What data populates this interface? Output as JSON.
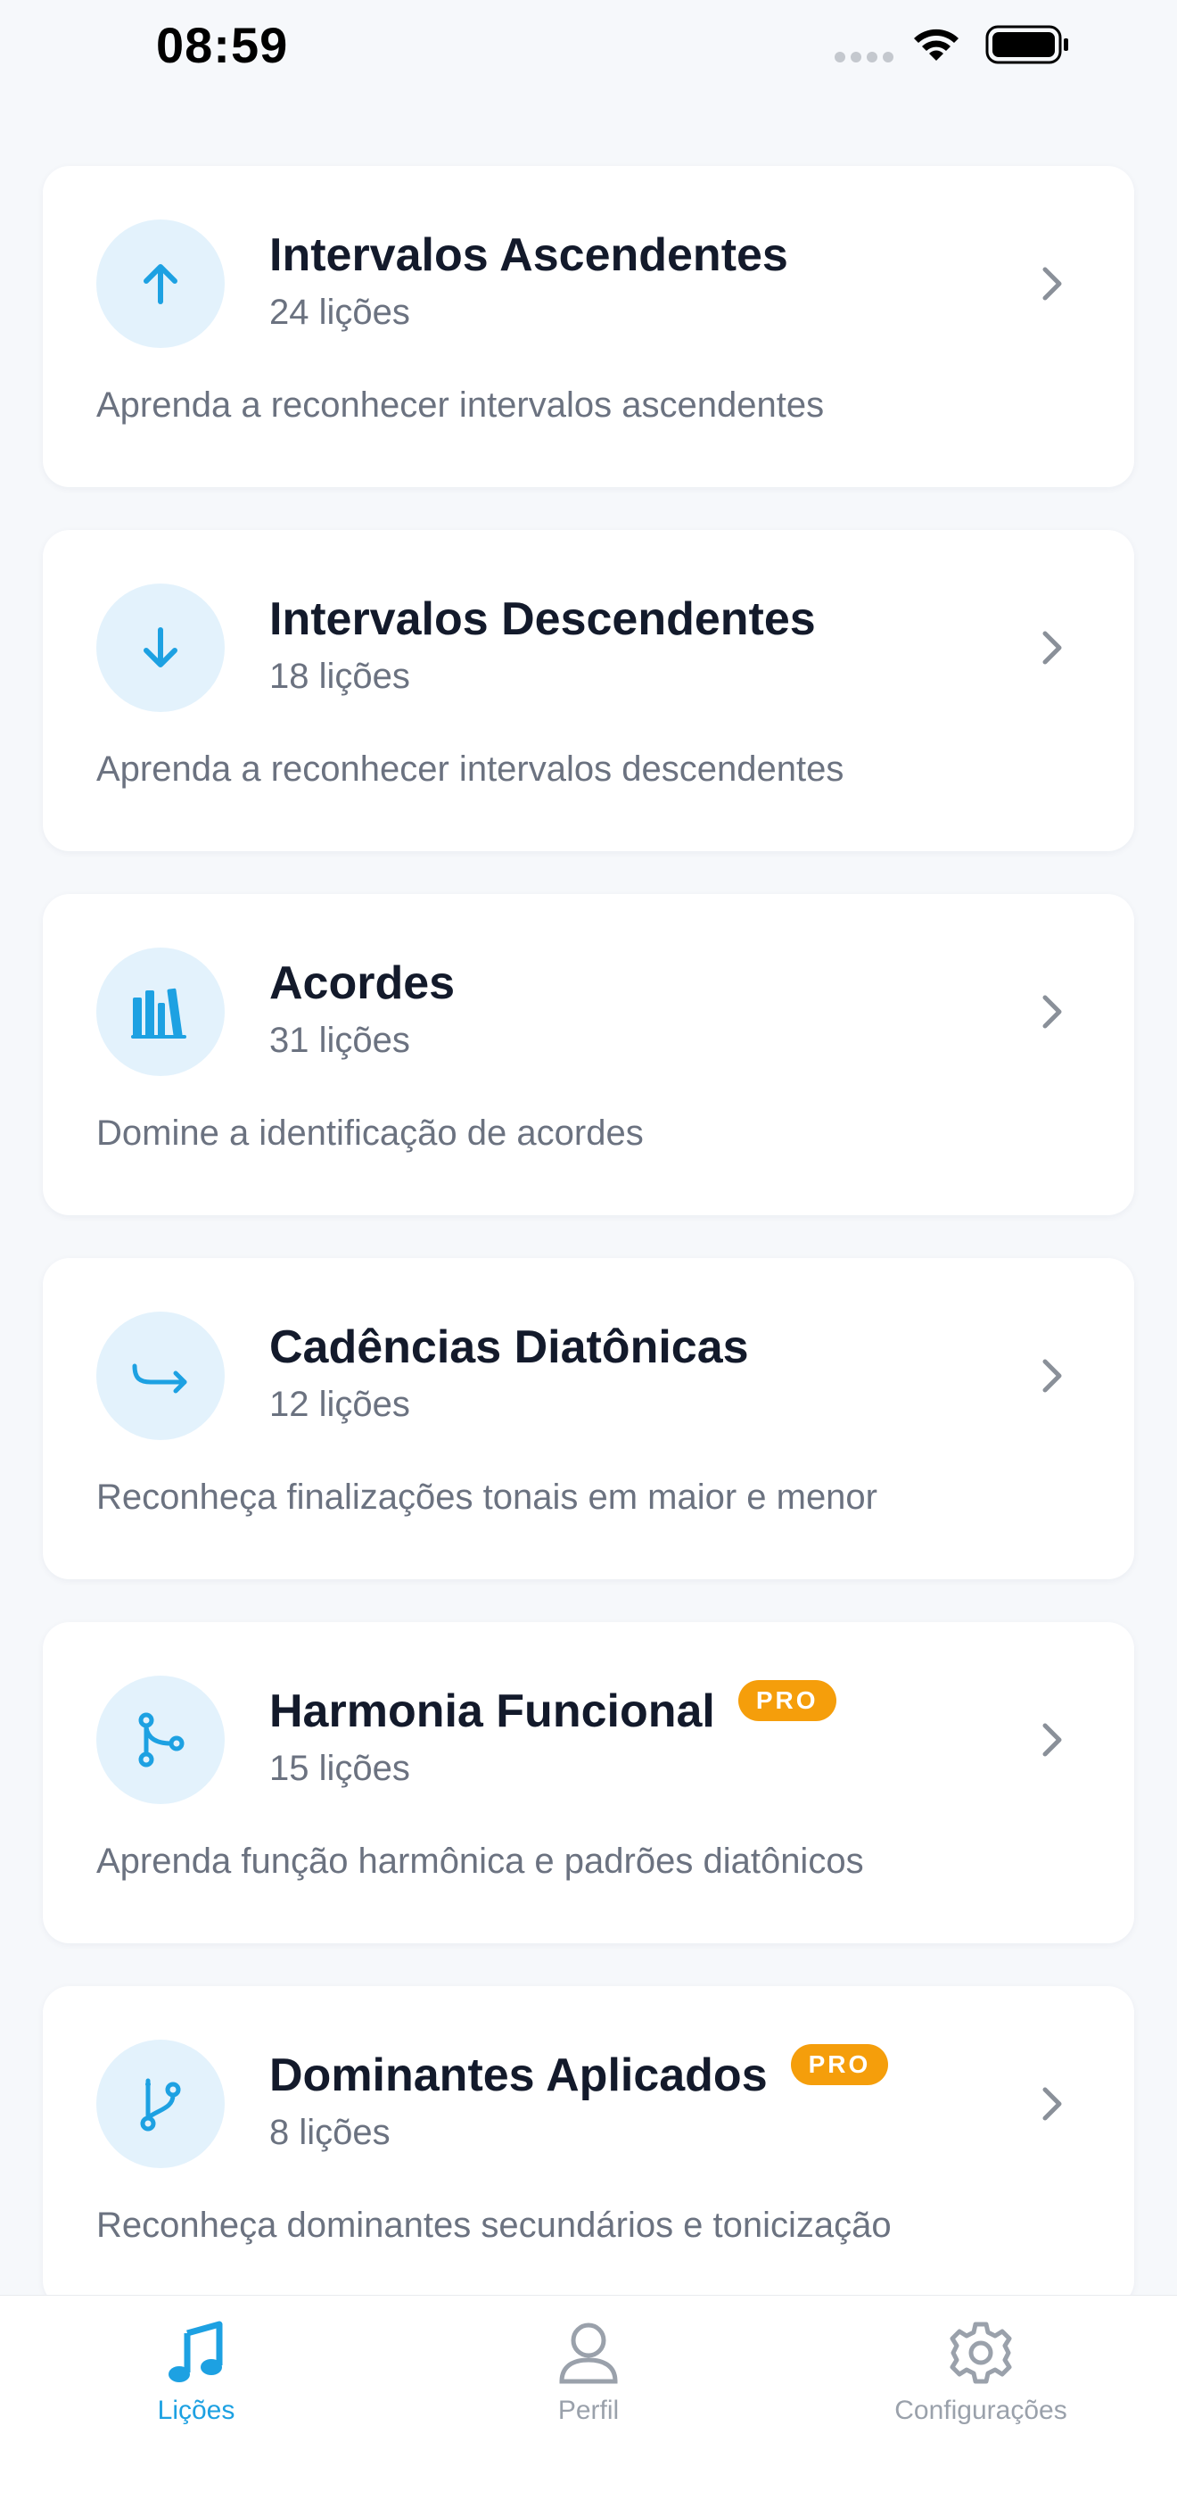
{
  "status_bar": {
    "time": "08:59"
  },
  "lessons": [
    {
      "title": "Intervalos Ascendentes",
      "count": "24 lições",
      "description": "Aprenda a reconhecer intervalos ascendentes",
      "icon": "arrow-up-icon"
    },
    {
      "title": "Intervalos Descendentes",
      "count": "18 lições",
      "description": "Aprenda a reconhecer intervalos descendentes",
      "icon": "arrow-down-icon"
    },
    {
      "title": "Acordes",
      "count": "31 lições",
      "description": "Domine a identificação de acordes",
      "icon": "chord-bars-icon"
    },
    {
      "title": "Cadências Diatônicas",
      "count": "12 lições",
      "description": "Reconheça finalizações tonais em maior e menor",
      "icon": "return-arrow-icon"
    },
    {
      "title": "Harmonia Funcional",
      "count": "15 lições",
      "description": "Aprenda função harmônica e padrões diatônicos",
      "icon": "branch-icon",
      "badge": "PRO"
    },
    {
      "title": "Dominantes Aplicados",
      "count": "8 lições",
      "description": "Reconheça dominantes secundários e tonicização",
      "icon": "git-branch-icon",
      "badge": "PRO"
    }
  ],
  "tabs": [
    {
      "label": "Lições",
      "icon": "music-note-icon",
      "active": true
    },
    {
      "label": "Perfil",
      "icon": "person-icon",
      "active": false
    },
    {
      "label": "Configurações",
      "icon": "gear-icon",
      "active": false
    }
  ],
  "colors": {
    "accent": "#1DA1E2",
    "icon_bg": "#E3F2FC",
    "pro": "#F59E0B",
    "background": "#F6F8FB"
  }
}
